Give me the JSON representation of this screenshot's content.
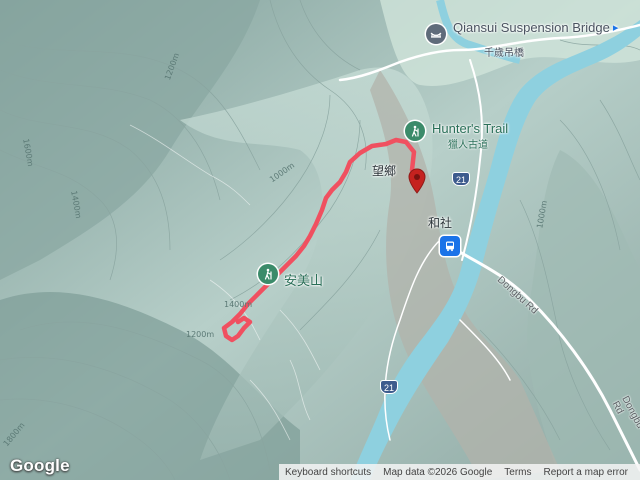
{
  "map": {
    "pois": [
      {
        "id": "bridge",
        "name": "Qiansui Suspension Bridge",
        "native": "千歲吊橋",
        "icon": "bridge-icon",
        "color": "#5f6b7a"
      },
      {
        "id": "trail",
        "name": "Hunter's Trail",
        "native": "獵人古道",
        "icon": "hiking-icon",
        "color": "#3b8b6a"
      },
      {
        "id": "peak",
        "name": "安美山",
        "icon": "hiking-icon",
        "color": "#3b8b6a"
      }
    ],
    "places": [
      "望鄉",
      "和社"
    ],
    "transit": {
      "icon": "bus-icon",
      "color": "#1a73e8"
    },
    "route_shield": "21",
    "road_name": "Dongbu Rd",
    "contours": [
      "1200m",
      "1400m",
      "1000m",
      "1000m",
      "1400m",
      "1600m",
      "1200m",
      "1800m"
    ],
    "marker": {
      "icon": "location-pin-icon",
      "color": "#c5221f"
    },
    "track": {
      "color": "#f05060"
    }
  },
  "attribution": {
    "logo": "Google",
    "keyboard": "Keyboard shortcuts",
    "data": "Map data ©2026 Google",
    "terms": "Terms",
    "report": "Report a map error"
  }
}
